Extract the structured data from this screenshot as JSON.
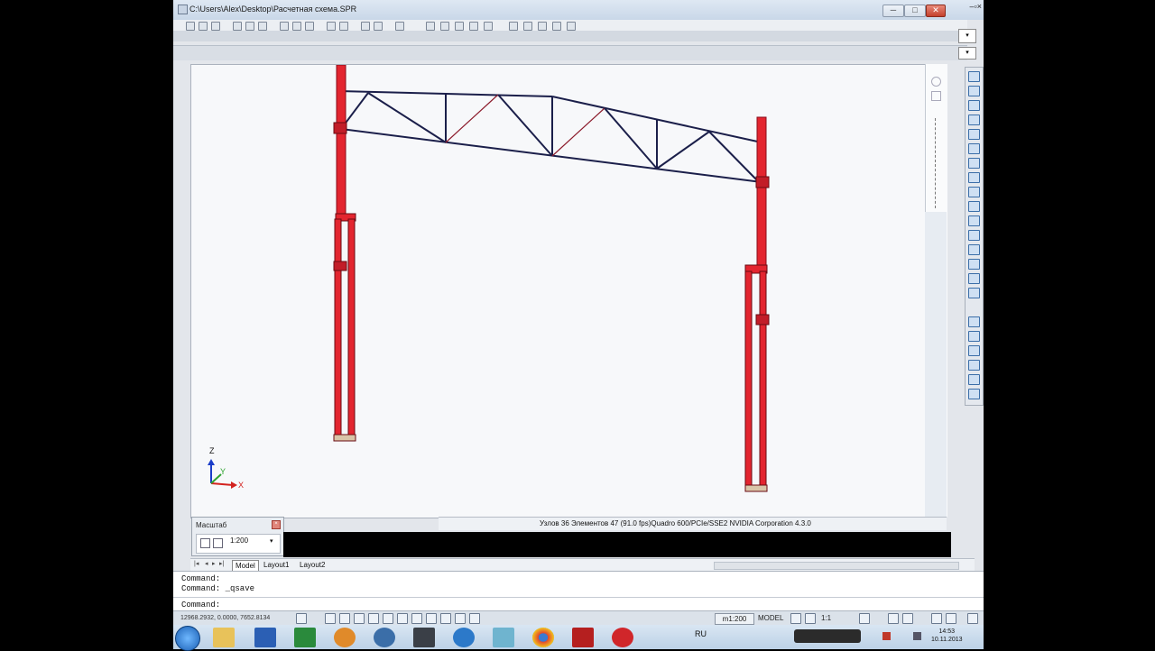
{
  "window": {
    "title": "C:\\Users\\Alex\\Desktop\\Расчетная схема.SPR",
    "min_label": "─",
    "max_label": "□",
    "close_label": "✕",
    "mdi_controls": "–▫×"
  },
  "viewport": {
    "status_text": "Узлов 36  Элементов 47  (91.0 fps)Quadro 600/PCIe/SSE2 NVIDIA Corporation 4.3.0",
    "axis_z": "Z",
    "axis_y": "Y",
    "axis_x": "X",
    "colors": {
      "column": "#e3252f",
      "truss": "#1b1f4a",
      "background": "#f7f8fa"
    }
  },
  "scale_panel": {
    "title": "Масштаб",
    "value": "1:200",
    "dropdown": "▾"
  },
  "tabs": {
    "model": "Model",
    "layout1": "Layout1",
    "layout2": "Layout2"
  },
  "command": {
    "line1": "Command:",
    "line2": "Command: _qsave",
    "prompt": "Command:"
  },
  "statusbar": {
    "coords": "12968.2932, 0.0000, 7652.8134",
    "scale": "m1:200",
    "model": "MODEL",
    "annotation": "1:1"
  },
  "taskbar": {
    "lang": "RU",
    "time": "14:53",
    "date": "10.11.2013"
  }
}
